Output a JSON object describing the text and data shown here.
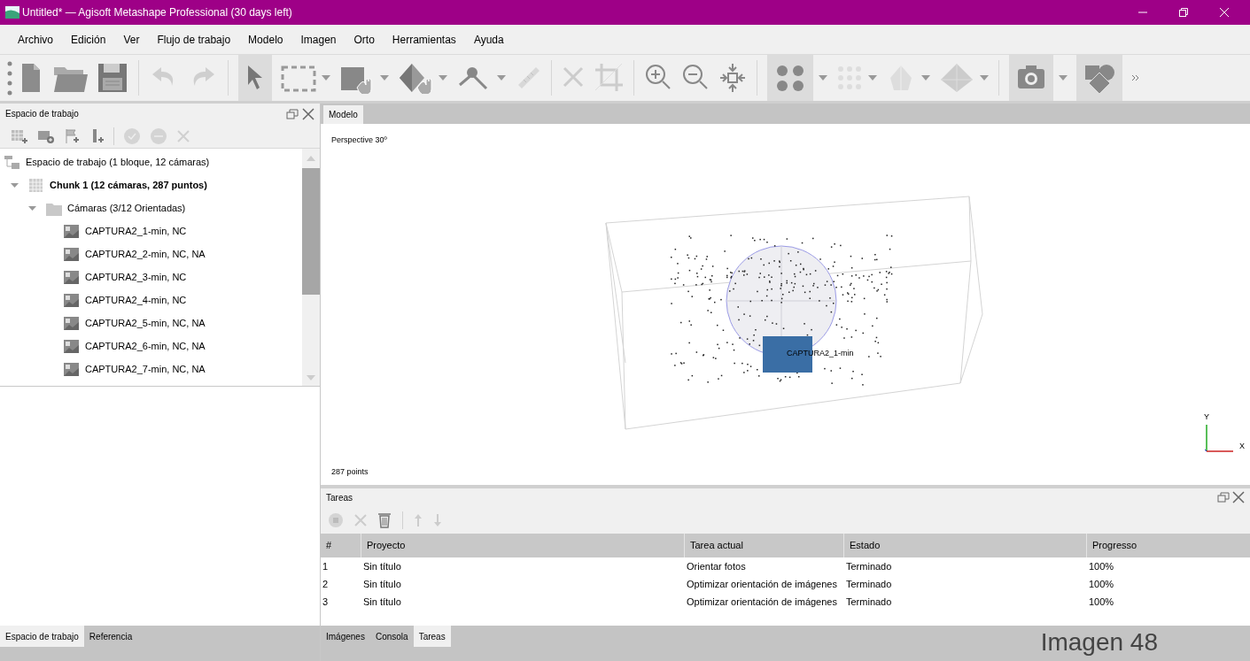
{
  "window": {
    "title": "Untitled* — Agisoft Metashape Professional (30 days left)"
  },
  "menu": [
    "Archivo",
    "Edición",
    "Ver",
    "Flujo de trabajo",
    "Modelo",
    "Imagen",
    "Orto",
    "Herramientas",
    "Ayuda"
  ],
  "workspace_panel": {
    "title": "Espacio de trabajo",
    "tree": [
      {
        "kind": "root",
        "label": "Espacio de trabajo (1 bloque, 12 cámaras)",
        "children": [
          {
            "kind": "chunk",
            "label": "Chunk 1 (12 cámaras, 287 puntos)",
            "expanded": true,
            "children": [
              {
                "kind": "folder",
                "label": "Cámaras (3/12 Orientadas)",
                "expanded": true,
                "children": [
                  {
                    "kind": "camera",
                    "label": "CAPTURA2_1-min, NC"
                  },
                  {
                    "kind": "camera",
                    "label": "CAPTURA2_2-min, NC, NA"
                  },
                  {
                    "kind": "camera",
                    "label": "CAPTURA2_3-min, NC"
                  },
                  {
                    "kind": "camera",
                    "label": "CAPTURA2_4-min, NC"
                  },
                  {
                    "kind": "camera",
                    "label": "CAPTURA2_5-min, NC, NA"
                  },
                  {
                    "kind": "camera",
                    "label": "CAPTURA2_6-min, NC, NA"
                  },
                  {
                    "kind": "camera",
                    "label": "CAPTURA2_7-min, NC, NA"
                  }
                ]
              }
            ]
          }
        ]
      }
    ]
  },
  "view_tabs": [
    {
      "label": "Modelo",
      "selected": true
    }
  ],
  "viewport": {
    "projection": "Perspective 30º",
    "point_count": "287 points",
    "camera_label": "CAPTURA2_1-min",
    "axis_y": "Y",
    "axis_x": "X"
  },
  "tasks_panel": {
    "title": "Tareas",
    "columns": [
      "#",
      "Proyecto",
      "Tarea actual",
      "Estado",
      "Progresso"
    ],
    "rows": [
      [
        "1",
        "Sin título",
        "Orientar fotos",
        "Terminado",
        "100%"
      ],
      [
        "2",
        "Sin título",
        "Optimizar orientación de imágenes",
        "Terminado",
        "100%"
      ],
      [
        "3",
        "Sin título",
        "Optimizar orientación de imágenes",
        "Terminado",
        "100%"
      ]
    ]
  },
  "left_tabs": [
    {
      "label": "Espacio de trabajo",
      "selected": true
    },
    {
      "label": "Referencia",
      "selected": false
    }
  ],
  "bottom_tabs": [
    {
      "label": "Imágenes",
      "selected": false
    },
    {
      "label": "Consola",
      "selected": false
    },
    {
      "label": "Tareas",
      "selected": true
    }
  ],
  "caption": "Imagen 48"
}
